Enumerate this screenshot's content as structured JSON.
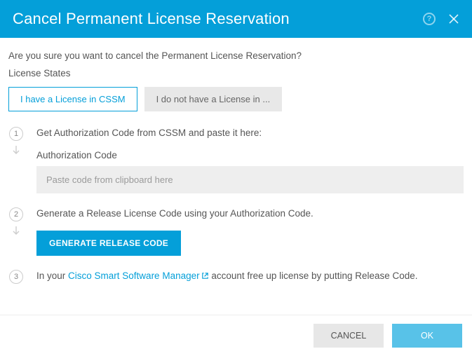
{
  "header": {
    "title": "Cancel Permanent License Reservation"
  },
  "confirm_text": "Are you sure you want to cancel the Permanent License Reservation?",
  "states_label": "License States",
  "tabs": {
    "have": "I have a License in CSSM",
    "not_have": "I do not have a License in ..."
  },
  "steps": {
    "one": {
      "num": "1",
      "text": "Get Authorization Code from CSSM and paste it here:",
      "field_label": "Authorization Code",
      "placeholder": "Paste code from clipboard here"
    },
    "two": {
      "num": "2",
      "text": "Generate a Release License Code using your Authorization Code.",
      "button": "GENERATE RELEASE CODE"
    },
    "three": {
      "num": "3",
      "prefix": "In your ",
      "link": "Cisco Smart Software Manager",
      "suffix": " account free up license by putting Release Code."
    }
  },
  "footer": {
    "cancel": "CANCEL",
    "ok": "OK"
  }
}
